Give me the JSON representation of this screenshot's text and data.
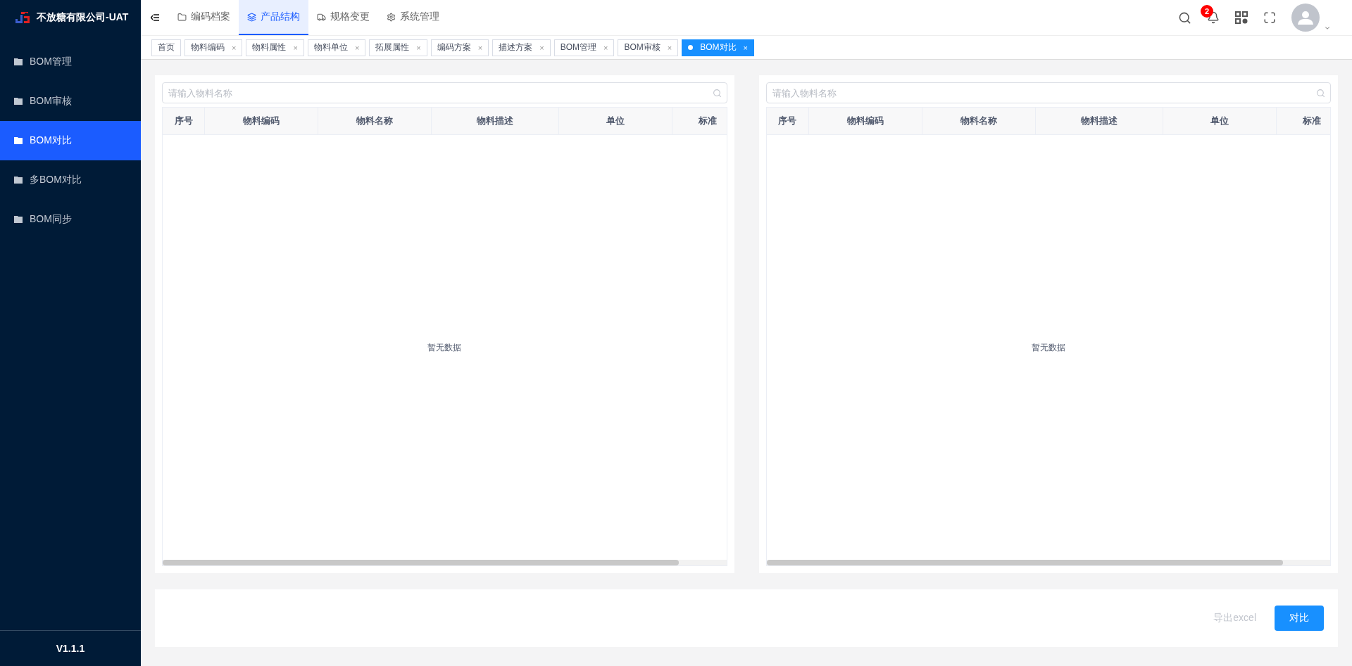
{
  "brand": {
    "title": "不放糖有限公司-UAT"
  },
  "sidebar": {
    "items": [
      {
        "label": "BOM管理",
        "selected": false
      },
      {
        "label": "BOM审核",
        "selected": false
      },
      {
        "label": "BOM对比",
        "selected": true
      },
      {
        "label": "多BOM对比",
        "selected": false
      },
      {
        "label": "BOM同步",
        "selected": false
      }
    ],
    "version": "V1.1.1"
  },
  "top_menu": [
    {
      "label": "编码档案",
      "selected": false
    },
    {
      "label": "产品结构",
      "selected": true
    },
    {
      "label": "规格变更",
      "selected": false
    },
    {
      "label": "系统管理",
      "selected": false
    }
  ],
  "notifications": {
    "count": "2"
  },
  "tabs": [
    {
      "label": "首页",
      "selected": false,
      "closable": false
    },
    {
      "label": "物料编码",
      "selected": false,
      "closable": true
    },
    {
      "label": "物料属性",
      "selected": false,
      "closable": true
    },
    {
      "label": "物料单位",
      "selected": false,
      "closable": true
    },
    {
      "label": "拓展属性",
      "selected": false,
      "closable": true
    },
    {
      "label": "编码方案",
      "selected": false,
      "closable": true
    },
    {
      "label": "描述方案",
      "selected": false,
      "closable": true
    },
    {
      "label": "BOM管理",
      "selected": false,
      "closable": true
    },
    {
      "label": "BOM审核",
      "selected": false,
      "closable": true
    },
    {
      "label": "BOM对比",
      "selected": true,
      "closable": true
    }
  ],
  "close_glyph": "×",
  "panels": [
    {
      "search": {
        "placeholder": "请输入物料名称"
      },
      "columns": [
        "序号",
        "物料编码",
        "物料名称",
        "物料描述",
        "单位",
        "标准"
      ],
      "empty_text": "暂无数据"
    },
    {
      "search": {
        "placeholder": "请输入物料名称"
      },
      "columns": [
        "序号",
        "物料编码",
        "物料名称",
        "物料描述",
        "单位",
        "标准"
      ],
      "empty_text": "暂无数据"
    }
  ],
  "actions": [
    {
      "label": "导出excel",
      "kind": "text",
      "disabled": true
    },
    {
      "label": "对比",
      "kind": "primary",
      "disabled": false
    }
  ]
}
